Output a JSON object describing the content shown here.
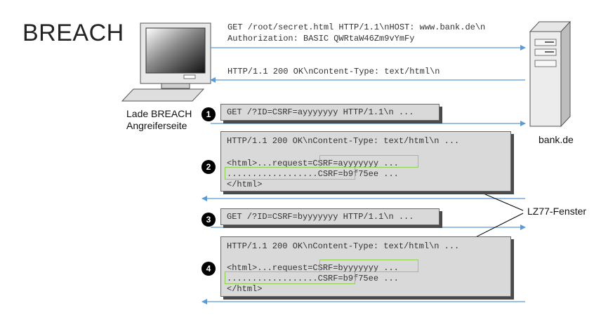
{
  "title": "BREACH",
  "client_label_line1": "Lade BREACH",
  "client_label_line2": "Angreiferseite",
  "server_label": "bank.de",
  "lz77_label": "LZ77-Fenster",
  "steps": [
    "1",
    "2",
    "3",
    "4"
  ],
  "messages": {
    "req_initial_line1": "GET /root/secret.html HTTP/1.1\\nHOST: www.bank.de\\n",
    "req_initial_line2": "Authorization: BASIC QWRtaW46Zm9vYmFy",
    "resp_initial": "HTTP/1.1 200 OK\\nContent-Type: text/html\\n",
    "req1": "GET /?ID=CSRF=ayyyyyyy HTTP/1.1\\n ...",
    "resp2_line1": "HTTP/1.1 200 OK\\nContent-Type: text/html\\n ...",
    "resp2_line3": "<html>...request=CSRF=ayyyyyyy ...",
    "resp2_line4": "..................CSRF=b9f75ee ...",
    "resp2_line5": "</html>",
    "req3": "GET /?ID=CSRF=byyyyyyy HTTP/1.1\\n ...",
    "resp4_line1": "HTTP/1.1 200 OK\\nContent-Type: text/html\\n ...",
    "resp4_line3": "<html>...request=CSRF=byyyyyyy ...",
    "resp4_line4": "..................CSRF=b9f75ee ...",
    "resp4_line5": "</html>"
  },
  "colors": {
    "arrow": "#5b9bd5",
    "highlight": "#8fd14f",
    "box_fill": "#d9d9d9",
    "badge": "#000000"
  }
}
